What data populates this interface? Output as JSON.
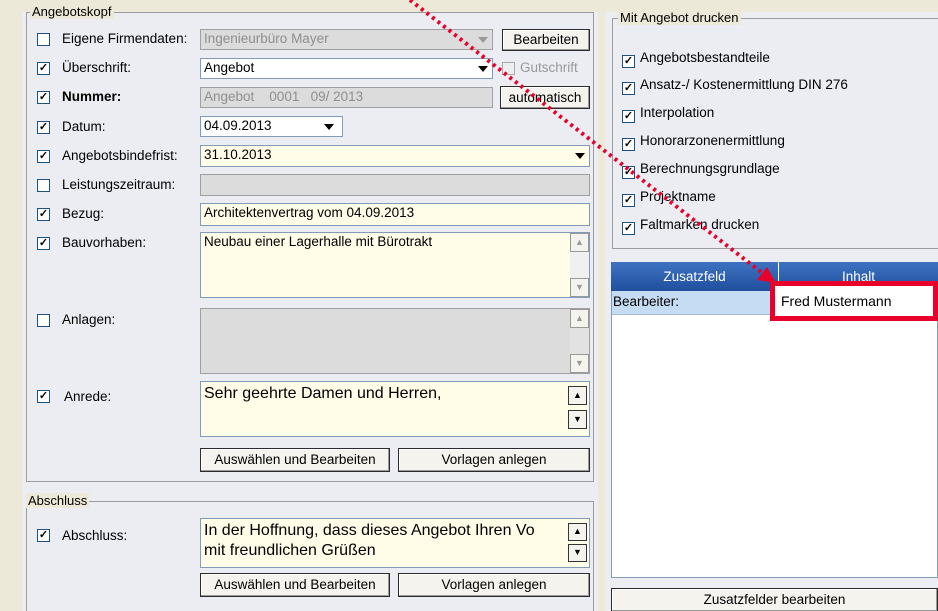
{
  "angebotskopf": {
    "title": "Angebotskopf",
    "rows": [
      {
        "label": "Eigene Firmendaten:",
        "checked": false,
        "bold": false,
        "value": "Ingenieurbüro Mayer"
      },
      {
        "label": "Überschrift:",
        "checked": true,
        "bold": false,
        "value": "Angebot"
      },
      {
        "label": "Nummer:",
        "checked": true,
        "bold": true,
        "value": "Angebot    0001   09/ 2013"
      },
      {
        "label": "Datum:",
        "checked": true,
        "bold": false,
        "value": "04.09.2013"
      },
      {
        "label": "Angebotsbindefrist:",
        "checked": true,
        "bold": false,
        "value": "31.10.2013"
      },
      {
        "label": "Leistungszeitraum:",
        "checked": false,
        "bold": false,
        "value": ""
      },
      {
        "label": "Bezug:",
        "checked": true,
        "bold": false,
        "value": "Architektenvertrag vom 04.09.2013"
      },
      {
        "label": "Bauvorhaben:",
        "checked": true,
        "bold": false,
        "value": "Neubau einer Lagerhalle mit Bürotrakt"
      },
      {
        "label": "Anlagen:",
        "checked": false,
        "bold": false,
        "value": ""
      },
      {
        "label": "Anrede:",
        "checked": true,
        "bold": false,
        "value": "Sehr geehrte Damen und Herren,"
      }
    ],
    "bearbeiten_label": "Bearbeiten",
    "gutschrift_label": "Gutschrift",
    "automatisch_label": "automatisch",
    "auswaehlen_label": "Auswählen und Bearbeiten",
    "vorlagen_label": "Vorlagen anlegen"
  },
  "abschluss": {
    "title": "Abschluss",
    "label": "Abschluss:",
    "checked": true,
    "line1": "In der Hoffnung, dass dieses Angebot Ihren Vo",
    "line2": "mit freundlichen Grüßen",
    "auswaehlen_label": "Auswählen und Bearbeiten",
    "vorlagen_label": "Vorlagen anlegen"
  },
  "mit_angebot_drucken": {
    "title": "Mit Angebot drucken",
    "items": [
      "Angebotsbestandteile",
      "Ansatz-/ Kostenermittlung DIN 276",
      "Interpolation",
      "Honorarzonenermittlung",
      "Berechnungsgrundlage",
      "Projektname",
      "Faltmarken drucken"
    ]
  },
  "zusatzfelder": {
    "col1": "Zusatzfeld",
    "col2": "Inhalt",
    "row_field": "Bearbeiter:",
    "row_value": "Fred Mustermann",
    "edit_label": "Zusatzfelder bearbeiten"
  },
  "colors": {
    "highlight": "#e8002a",
    "grid_header": "#2a5aaa",
    "selected_row": "#c6dcf3"
  }
}
